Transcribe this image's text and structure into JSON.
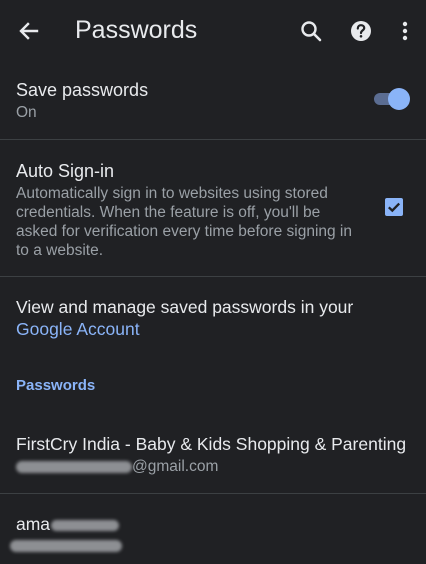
{
  "appbar": {
    "title": "Passwords",
    "back_icon": "arrow-left-icon",
    "search_icon": "search-icon",
    "help_icon": "help-icon",
    "more_icon": "more-vert-icon"
  },
  "save_passwords": {
    "title": "Save passwords",
    "status": "On",
    "toggle_on": true
  },
  "auto_signin": {
    "title": "Auto Sign-in",
    "description": "Automatically sign in to websites using stored credentials. When the feature is off, you'll be asked for verification every time before signing in to a website.",
    "checked": true
  },
  "manage": {
    "text": "View and manage saved passwords in your",
    "link": "Google Account"
  },
  "passwords_section": {
    "header": "Passwords",
    "items": [
      {
        "site": "FirstCry India - Baby & Kids Shopping & Parenting",
        "user_suffix": "@gmail.com"
      },
      {
        "site": "ama",
        "user_suffix": ""
      }
    ]
  },
  "colors": {
    "background": "#202124",
    "accent": "#8ab4f8",
    "text_primary": "#e8eaed",
    "text_secondary": "#9aa0a6",
    "divider": "#3c4043"
  }
}
